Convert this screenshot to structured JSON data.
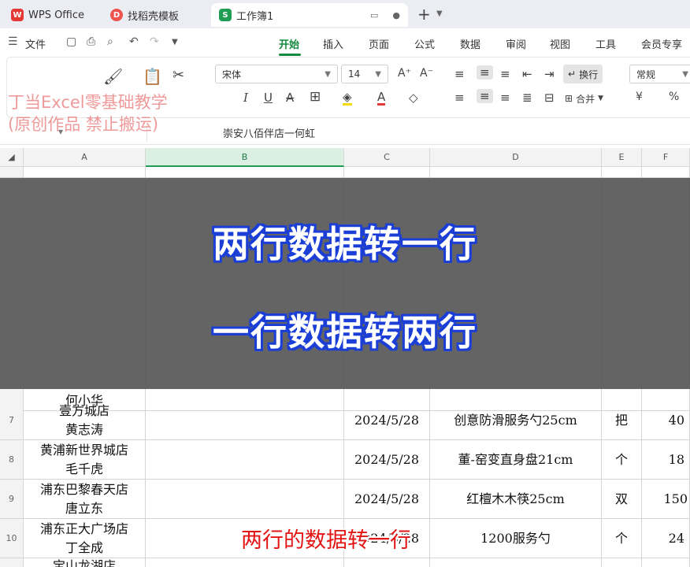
{
  "tabs": [
    {
      "label": "WPS Office",
      "icon": "wps-logo-icon"
    },
    {
      "label": "找稻壳模板",
      "icon": "docer-icon"
    },
    {
      "label": "工作簿1",
      "icon": "spreadsheet-icon"
    }
  ],
  "tab_new": "+",
  "menu": {
    "file": "文件",
    "items": [
      "开始",
      "插入",
      "页面",
      "公式",
      "数据",
      "审阅",
      "视图",
      "工具",
      "会员专享"
    ]
  },
  "ribbon": {
    "font_name": "宋体",
    "font_size": "14",
    "wrap_label": "换行",
    "merge_label": "合并",
    "number_format": "常规",
    "percent": "%",
    "currency": "¥"
  },
  "formula_bar": {
    "content": "崇安八佰伴店一何虹"
  },
  "columns": [
    "A",
    "B",
    "C",
    "D",
    "E",
    "F"
  ],
  "rows": [
    {
      "num": "",
      "a": [
        "",
        ""
      ],
      "b": "",
      "c": "",
      "d": "",
      "e": "",
      "f": ""
    },
    {
      "num": "",
      "a": [
        "",
        "何小华"
      ],
      "b": "",
      "c": "",
      "d": "",
      "e": "",
      "f": ""
    },
    {
      "num": "7",
      "a": [
        "壹方城店",
        "黄志涛"
      ],
      "b": "",
      "c": "2024/5/28",
      "d": "创意防滑服务勺25cm",
      "e": "把",
      "f": "40"
    },
    {
      "num": "8",
      "a": [
        "黄浦新世界城店",
        "毛千虎"
      ],
      "b": "",
      "c": "2024/5/28",
      "d": "董-窑变直身盘21cm",
      "e": "个",
      "f": "18"
    },
    {
      "num": "9",
      "a": [
        "浦东巴黎春天店",
        "唐立东"
      ],
      "b": "",
      "c": "2024/5/28",
      "d": "红檀木木筷25cm",
      "e": "双",
      "f": "150"
    },
    {
      "num": "10",
      "a": [
        "浦东正大广场店",
        "丁全成"
      ],
      "b": "",
      "c": "2024/5/28",
      "d": "1200服务勺",
      "e": "个",
      "f": "24"
    },
    {
      "num": "",
      "a": [
        "宝山龙湖店",
        ""
      ],
      "b": "",
      "c": "",
      "d": "",
      "e": "",
      "f": ""
    }
  ],
  "overlay": {
    "line1": "两行数据转一行",
    "line2": "一行数据转两行"
  },
  "watermark": {
    "line1": "丁当Excel零基础教学",
    "line2": "(原创作品 禁止搬运)"
  },
  "caption": "两行的数据转一行"
}
